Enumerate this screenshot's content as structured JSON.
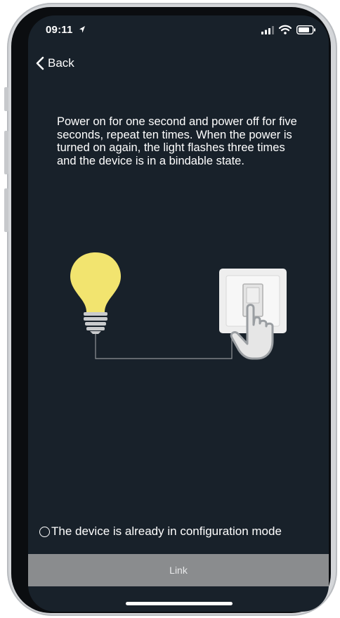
{
  "status_bar": {
    "time": "09:11",
    "location_icon": "location-arrow-icon",
    "signal_icon": "cellular-signal-icon",
    "wifi_icon": "wifi-icon",
    "battery_icon": "battery-icon"
  },
  "nav": {
    "back_label": "Back",
    "back_icon": "chevron-left-icon"
  },
  "instructions": "Power on for one second and power off for five seconds, repeat ten times. When the power is turned on again, the light flashes three times and the device is in a bindable state.",
  "illustration": {
    "bulb_color": "#f2e46f",
    "switch_color": "#eeeeee",
    "icons": [
      "light-bulb-icon",
      "wall-switch-icon",
      "pointing-hand-icon"
    ]
  },
  "config_option": {
    "label": "The device is already in configuration mode",
    "checked": false
  },
  "link_button": {
    "label": "Link"
  },
  "colors": {
    "background": "#18212a",
    "button": "#8a8c8e",
    "text": "#ffffff"
  }
}
